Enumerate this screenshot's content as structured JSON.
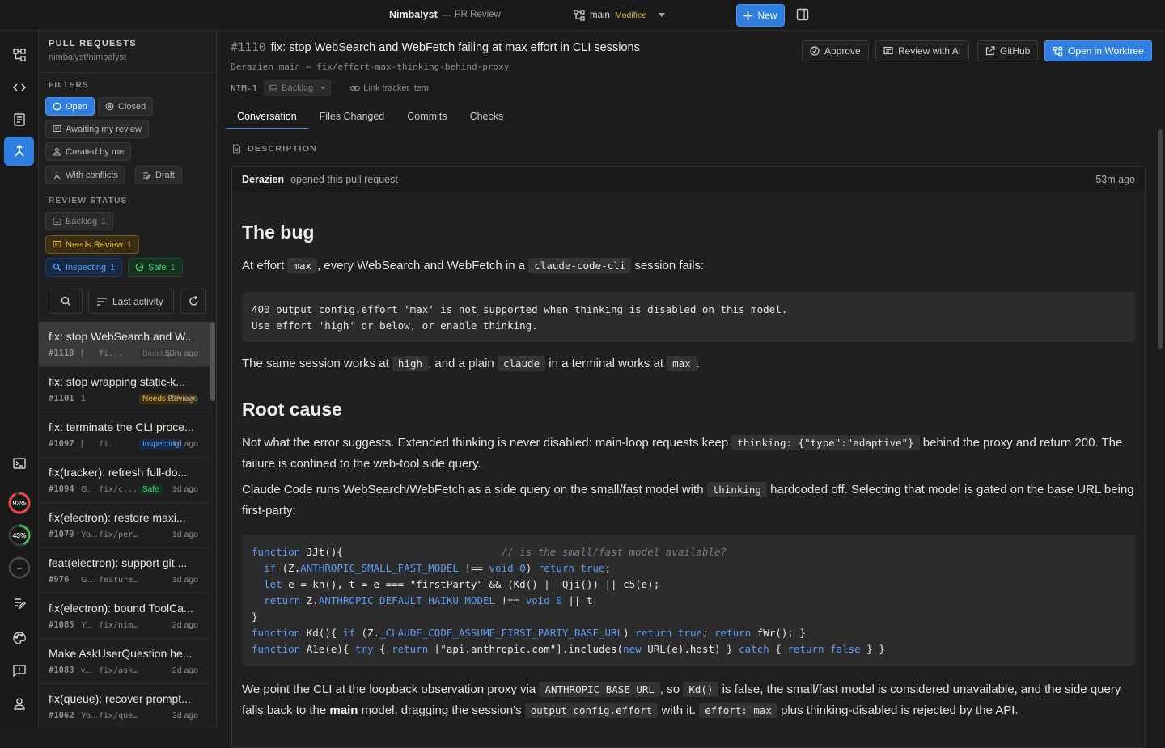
{
  "topbar": {
    "app_title": "Nimbalyst",
    "separator": "—",
    "subtitle": "PR Review",
    "branch": "main",
    "branch_state": "Modified",
    "new_label": "New"
  },
  "rail": {
    "gauges": [
      "93%",
      "43%",
      "--"
    ]
  },
  "sidebar": {
    "title": "PULL REQUESTS",
    "repo": "nimbalyst/nimbalyst",
    "filters_label": "FILTERS",
    "filters": {
      "open": "Open",
      "closed": "Closed",
      "awaiting": "Awaiting my review",
      "created": "Created by me",
      "conflicts": "With conflicts",
      "draft": "Draft"
    },
    "review_label": "REVIEW STATUS",
    "review": {
      "backlog": {
        "label": "Backlog",
        "count": "1"
      },
      "needs": {
        "label": "Needs Review",
        "count": "1"
      },
      "inspecting": {
        "label": "Inspecting",
        "count": "1"
      },
      "safe": {
        "label": "Safe",
        "count": "1"
      }
    },
    "sort_label": "Last activity",
    "items": [
      {
        "title": "fix: stop WebSearch and W...",
        "num": "#1110",
        "author": "[",
        "branch": "fi...",
        "status": "Backlog",
        "status_kind": "backlog",
        "time": "53m ago"
      },
      {
        "title": "fix: stop wrapping static-k...",
        "num": "#1101",
        "author": "1",
        "branch": "",
        "status": "Needs Review",
        "status_kind": "needs",
        "time": "21h ago"
      },
      {
        "title": "fix: terminate the CLI proce...",
        "num": "#1097",
        "author": "[",
        "branch": "fi...",
        "status": "Inspecting",
        "status_kind": "insp",
        "time": "1d ago"
      },
      {
        "title": "fix(tracker): refresh full-do...",
        "num": "#1094",
        "author": "G..",
        "branch": "fix/c...",
        "status": "Safe",
        "status_kind": "safe",
        "time": "1d ago"
      },
      {
        "title": "fix(electron): restore maxi...",
        "num": "#1079",
        "author": "Yo...",
        "branch": "fix/persi...",
        "status": "",
        "status_kind": "",
        "time": "1d ago"
      },
      {
        "title": "feat(electron): support git ...",
        "num": "#976",
        "author": "Ge...",
        "branch": "feature/mu...",
        "status": "",
        "status_kind": "",
        "time": "1d ago"
      },
      {
        "title": "fix(electron): bound ToolCa...",
        "num": "#1085",
        "author": "Y...",
        "branch": "fix/nim-48...",
        "status": "",
        "status_kind": "",
        "time": "2d ago"
      },
      {
        "title": "Make AskUserQuestion he...",
        "num": "#1083",
        "author": "v...",
        "branch": "fix/ask-us...",
        "status": "",
        "status_kind": "",
        "time": "2d ago"
      },
      {
        "title": "fix(queue): recover prompt...",
        "num": "#1062",
        "author": "Yo...",
        "branch": "fix/queue...",
        "status": "",
        "status_kind": "",
        "time": "3d ago"
      }
    ]
  },
  "pr": {
    "number": "#1110",
    "title": "fix: stop WebSearch and WebFetch failing at max effort in CLI sessions",
    "branches": "Derazien  main ← fix/effort-max-thinking-behind-proxy",
    "ticket": "NIM-1",
    "backlog": "Backlog",
    "link_tracker": "Link tracker item",
    "actions": {
      "approve": "Approve",
      "review_ai": "Review with AI",
      "github": "GitHub",
      "worktree": "Open in Worktree"
    }
  },
  "tabs": [
    "Conversation",
    "Files Changed",
    "Commits",
    "Checks"
  ],
  "description": {
    "label": "DESCRIPTION",
    "author": "Derazien",
    "action": "opened this pull request",
    "time": "53m ago",
    "h_bug": "The bug",
    "p1": {
      "a": "At effort",
      "code1": "max",
      "b": ", every WebSearch and WebFetch in a",
      "code2": "claude-code-cli",
      "c": "session fails:"
    },
    "err_line1": "400 output_config.effort 'max' is not supported when thinking is disabled on this model.",
    "err_line2": "Use effort 'high' or below, or enable thinking.",
    "p2": {
      "a": "The same session works at",
      "code1": "high",
      "b": ", and a plain",
      "code2": "claude",
      "c": "in a terminal works at",
      "code3": "max",
      "d": "."
    },
    "h_root": "Root cause",
    "p3": {
      "a": "Not what the error suggests. Extended thinking is never disabled: main-loop requests keep",
      "code1": "thinking: {\"type\":\"adaptive\"}",
      "b": "behind the proxy and return 200. The failure is confined to the web-tool side query."
    },
    "p4": {
      "a": "Claude Code runs WebSearch/WebFetch as a side query on the small/fast model with",
      "code1": "thinking",
      "b": "hardcoded off. Selecting that model is gated on the base URL being first-party:"
    },
    "p5": {
      "a": "We point the CLI at the loopback observation proxy via",
      "code1": "ANTHROPIC_BASE_URL",
      "b": ", so",
      "code2": "Kd()",
      "c": "is false, the small/fast model is considered unavailable, and the side query falls back to the",
      "bold": "main",
      "d": "model, dragging the session's",
      "code3": "output_config.effort",
      "e": "with it.",
      "code4": "effort: max",
      "f": "plus thinking-disabled is rejected by the API."
    }
  }
}
